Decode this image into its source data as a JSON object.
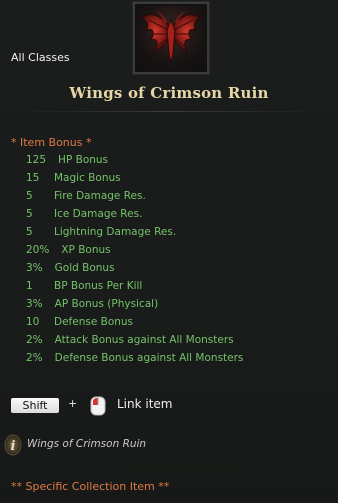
{
  "item": {
    "icon": "crimson-wings-icon",
    "classes": "All Classes",
    "name": "Wings of Crimson Ruin"
  },
  "item_bonus": {
    "header": "*  Item Bonus *",
    "entries": [
      {
        "value": "125",
        "label": "HP Bonus"
      },
      {
        "value": "15",
        "label": "Magic Bonus"
      },
      {
        "value": "5",
        "label": "Fire Damage Res."
      },
      {
        "value": "5",
        "label": "Ice Damage Res."
      },
      {
        "value": "5",
        "label": "Lightning Damage Res."
      },
      {
        "value": "20%",
        "label": "XP Bonus"
      },
      {
        "value": "3%",
        "label": "Gold Bonus"
      },
      {
        "value": "1",
        "label": "BP Bonus Per Kill"
      },
      {
        "value": "3%",
        "label": "AP Bonus (Physical)"
      },
      {
        "value": "10",
        "label": "Defense Bonus"
      },
      {
        "value": "2%",
        "label": "Attack Bonus against All Monsters"
      },
      {
        "value": "2%",
        "label": "Defense Bonus against All Monsters"
      }
    ]
  },
  "link_hint": {
    "key": "Shift",
    "plus": "+",
    "mouse_icon": "mouse-left-click-icon",
    "action": "Link item"
  },
  "info": {
    "icon": "info-icon",
    "name": "Wings of Crimson Ruin"
  },
  "collection_note": "** Specific Collection Item **",
  "colors": {
    "title": "#e7d6a4",
    "bonus_header": "#e07a45",
    "bonus_entry": "#74c26a",
    "background": "#1b1d1c"
  }
}
